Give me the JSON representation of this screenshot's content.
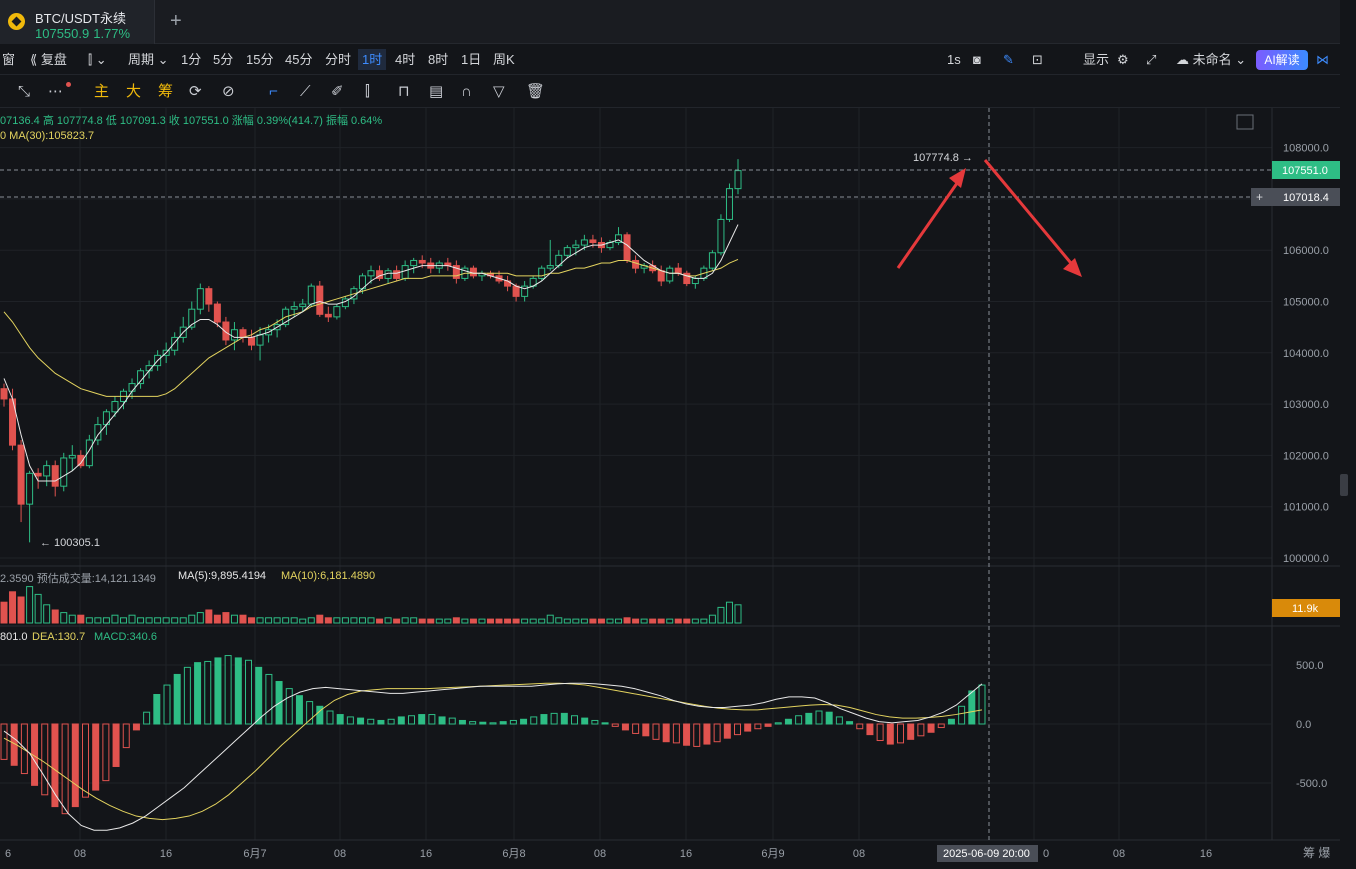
{
  "tab": {
    "symbol": "BTC/USDT永续",
    "price": "107550.9",
    "change": "1.77%",
    "new_tab": "+"
  },
  "toolbar": {
    "left_items": [
      "窗",
      "复盘",
      "",
      "周期"
    ],
    "intervals": [
      "1分",
      "5分",
      "15分",
      "45分",
      "分时",
      "1时",
      "4时",
      "8时",
      "1日",
      "周K"
    ],
    "active_interval": "1时",
    "right_items": [
      "1s",
      "显示",
      "未命名"
    ],
    "ai_label": "AI解读"
  },
  "toolbar2": {
    "chars": [
      "主",
      "大",
      "筹"
    ]
  },
  "info": {
    "ohlc": "07136.4  高 107774.8  低 107091.3  收 107551.0  涨幅 0.39%(414.7)  振幅 0.64%",
    "ma_label": "0  MA(30):105823.7",
    "vol": "2.3590  预估成交量:14,121.1349",
    "vol_ma5": "MA(5):9,895.4194",
    "vol_ma10": "MA(10):6,181.4890",
    "macd_dif": "801.0",
    "macd_dea": "DEA:130.7",
    "macd_val": "MACD:340.6"
  },
  "price_tags": {
    "last": "107551.0",
    "cursor": "107018.4",
    "vol_last": "11.9k",
    "high_label": "107774.8",
    "low_label": "100305.1"
  },
  "x_axis": {
    "labels": [
      "6",
      "08",
      "16",
      "6月7",
      "08",
      "16",
      "6月8",
      "08",
      "16",
      "6月9",
      "08",
      "0",
      "08",
      "16"
    ],
    "cursor_time": "2025-06-09 20:00",
    "corner": "筹  爆"
  },
  "colors": {
    "up": "#2ebd85",
    "down": "#e0534f",
    "ma_fast": "#e8e8e8",
    "ma_slow": "#e3d35f",
    "accent": "#3d8bfd",
    "arrow": "#e5393b"
  },
  "chart_data": [
    {
      "type": "candlestick",
      "title": "",
      "y_ticks": [
        108000.0,
        107000.0,
        106000.0,
        105000.0,
        104000.0,
        103000.0,
        102000.0,
        101000.0,
        100000.0
      ],
      "ylim": [
        99700,
        108300
      ],
      "interval": "1h",
      "candles": [
        [
          103300,
          103400,
          102950,
          103100
        ],
        [
          103100,
          103300,
          102100,
          102200
        ],
        [
          102200,
          102300,
          100700,
          101050
        ],
        [
          101050,
          101700,
          100305,
          101650
        ],
        [
          101650,
          101750,
          101350,
          101600
        ],
        [
          101600,
          101900,
          101400,
          101800
        ],
        [
          101800,
          101900,
          101200,
          101400
        ],
        [
          101400,
          102050,
          101300,
          101950
        ],
        [
          101950,
          102200,
          101700,
          102000
        ],
        [
          102000,
          102100,
          101750,
          101800
        ],
        [
          101800,
          102400,
          101750,
          102300
        ],
        [
          102300,
          102750,
          102200,
          102600
        ],
        [
          102600,
          102900,
          102400,
          102850
        ],
        [
          102850,
          103150,
          102750,
          103050
        ],
        [
          103050,
          103300,
          102900,
          103250
        ],
        [
          103250,
          103500,
          103100,
          103400
        ],
        [
          103400,
          103700,
          103300,
          103650
        ],
        [
          103650,
          103850,
          103500,
          103750
        ],
        [
          103750,
          104050,
          103650,
          103950
        ],
        [
          103950,
          104200,
          103800,
          104050
        ],
        [
          104050,
          104400,
          103950,
          104300
        ],
        [
          104300,
          104700,
          104200,
          104500
        ],
        [
          104500,
          105000,
          104450,
          104850
        ],
        [
          104850,
          105350,
          104750,
          105250
        ],
        [
          105250,
          105300,
          104800,
          104950
        ],
        [
          104950,
          105000,
          104500,
          104600
        ],
        [
          104600,
          104700,
          104150,
          104250
        ],
        [
          104250,
          104600,
          104050,
          104450
        ],
        [
          104450,
          104500,
          104200,
          104300
        ],
        [
          104300,
          104450,
          104050,
          104150
        ],
        [
          104150,
          104500,
          103850,
          104350
        ],
        [
          104350,
          104550,
          104200,
          104450
        ],
        [
          104450,
          104650,
          104300,
          104550
        ],
        [
          104550,
          104900,
          104500,
          104850
        ],
        [
          104850,
          105000,
          104700,
          104900
        ],
        [
          104900,
          105050,
          104800,
          104950
        ],
        [
          104950,
          105350,
          104900,
          105300
        ],
        [
          105300,
          105400,
          104700,
          104750
        ],
        [
          104750,
          104900,
          104600,
          104700
        ],
        [
          104700,
          104950,
          104650,
          104900
        ],
        [
          104900,
          105100,
          104850,
          105050
        ],
        [
          105050,
          105300,
          104950,
          105250
        ],
        [
          105250,
          105550,
          105150,
          105500
        ],
        [
          105500,
          105700,
          105350,
          105600
        ],
        [
          105600,
          105700,
          105400,
          105450
        ],
        [
          105450,
          105650,
          105350,
          105600
        ],
        [
          105600,
          105700,
          105400,
          105450
        ],
        [
          105450,
          105800,
          105400,
          105700
        ],
        [
          105700,
          105850,
          105550,
          105800
        ],
        [
          105800,
          105900,
          105650,
          105750
        ],
        [
          105750,
          105850,
          105550,
          105650
        ],
        [
          105650,
          105800,
          105550,
          105750
        ],
        [
          105750,
          105850,
          105600,
          105700
        ],
        [
          105700,
          105800,
          105350,
          105450
        ],
        [
          105450,
          105700,
          105400,
          105650
        ],
        [
          105650,
          105700,
          105450,
          105500
        ],
        [
          105500,
          105600,
          105400,
          105550
        ],
        [
          105550,
          105600,
          105450,
          105500
        ],
        [
          105500,
          105600,
          105350,
          105400
        ],
        [
          105400,
          105500,
          105200,
          105300
        ],
        [
          105300,
          105350,
          105000,
          105100
        ],
        [
          105100,
          105400,
          105000,
          105300
        ],
        [
          105300,
          105500,
          105250,
          105450
        ],
        [
          105450,
          105700,
          105400,
          105650
        ],
        [
          105650,
          106200,
          105600,
          105700
        ],
        [
          105700,
          106000,
          105650,
          105900
        ],
        [
          105900,
          106100,
          105850,
          106050
        ],
        [
          106050,
          106200,
          105900,
          106100
        ],
        [
          106100,
          106300,
          106000,
          106200
        ],
        [
          106200,
          106300,
          106050,
          106150
        ],
        [
          106150,
          106250,
          105950,
          106050
        ],
        [
          106050,
          106200,
          106000,
          106150
        ],
        [
          106150,
          106450,
          106100,
          106300
        ],
        [
          106300,
          106350,
          105750,
          105800
        ],
        [
          105800,
          105900,
          105550,
          105650
        ],
        [
          105650,
          105750,
          105550,
          105700
        ],
        [
          105700,
          105800,
          105550,
          105600
        ],
        [
          105600,
          105700,
          105300,
          105400
        ],
        [
          105400,
          105700,
          105350,
          105650
        ],
        [
          105650,
          105750,
          105500,
          105550
        ],
        [
          105550,
          105600,
          105300,
          105350
        ],
        [
          105350,
          105500,
          105250,
          105450
        ],
        [
          105450,
          105700,
          105400,
          105650
        ],
        [
          105650,
          106000,
          105600,
          105950
        ],
        [
          105950,
          106700,
          105900,
          106600
        ],
        [
          106600,
          107300,
          106550,
          107200
        ],
        [
          107200,
          107775,
          107091,
          107551
        ]
      ],
      "ma_fast": {
        "name": "",
        "values": [
          103500,
          103100,
          102400,
          101800,
          101500,
          101500,
          101500,
          101600,
          101700,
          101850,
          102100,
          102400,
          102600,
          102800,
          103000,
          103250,
          103450,
          103650,
          103850,
          104000,
          104200,
          104400,
          104550,
          104650,
          104650,
          104550,
          104400,
          104300,
          104300,
          104300,
          104350,
          104400,
          104500,
          104600,
          104700,
          104800,
          104950,
          105000,
          104950,
          104950,
          105000,
          105100,
          105250,
          105400,
          105500,
          105550,
          105550,
          105600,
          105650,
          105700,
          105700,
          105700,
          105700,
          105650,
          105600,
          105550,
          105550,
          105500,
          105450,
          105400,
          105300,
          105250,
          105300,
          105400,
          105550,
          105700,
          105850,
          105950,
          106050,
          106100,
          106100,
          106150,
          106200,
          106100,
          105950,
          105800,
          105700,
          105600,
          105550,
          105550,
          105500,
          105450,
          105450,
          105550,
          105800,
          106150,
          106500
        ]
      },
      "ma_slow": {
        "name": "MA(30)",
        "values": [
          104800,
          104600,
          104350,
          104100,
          103900,
          103750,
          103600,
          103500,
          103400,
          103300,
          103250,
          103200,
          103150,
          103150,
          103150,
          103150,
          103150,
          103150,
          103150,
          103200,
          103300,
          103450,
          103600,
          103750,
          103900,
          104000,
          104100,
          104200,
          104300,
          104350,
          104450,
          104500,
          104600,
          104700,
          104750,
          104800,
          104900,
          104950,
          105000,
          105050,
          105100,
          105150,
          105200,
          105250,
          105300,
          105350,
          105400,
          105450,
          105450,
          105450,
          105500,
          105500,
          105500,
          105500,
          105550,
          105550,
          105550,
          105550,
          105550,
          105550,
          105500,
          105500,
          105500,
          105500,
          105550,
          105550,
          105600,
          105650,
          105650,
          105700,
          105750,
          105750,
          105800,
          105800,
          105750,
          105700,
          105650,
          105600,
          105550,
          105550,
          105500,
          105500,
          105550,
          105600,
          105650,
          105750,
          105820
        ]
      }
    },
    {
      "type": "bar",
      "title": "",
      "values": [
        8,
        12,
        10,
        14,
        11,
        7,
        5,
        4,
        3,
        3,
        2,
        2,
        2,
        3,
        2,
        3,
        2,
        2,
        2,
        2,
        2,
        2,
        3,
        4,
        5,
        3,
        4,
        3,
        3,
        2,
        2,
        2,
        2,
        2,
        2,
        1.5,
        2,
        3,
        2,
        2,
        2,
        2,
        2,
        2,
        1.5,
        2,
        1.5,
        2,
        2,
        1.5,
        1.5,
        1.5,
        1.5,
        2,
        1.5,
        1.5,
        1.5,
        1.5,
        1.5,
        1.5,
        1.5,
        1.5,
        1.5,
        1.5,
        3,
        2,
        1.5,
        1.5,
        1.5,
        1.5,
        1.5,
        1.5,
        1.5,
        2,
        1.5,
        1.5,
        1.5,
        1.5,
        1.5,
        1.5,
        1.5,
        1.5,
        1.5,
        3,
        6,
        8,
        7
      ],
      "up": [
        false,
        false,
        false,
        true,
        true,
        true,
        false,
        true,
        true,
        false,
        true,
        true,
        true,
        true,
        true,
        true,
        true,
        true,
        true,
        true,
        true,
        true,
        true,
        true,
        false,
        false,
        false,
        true,
        false,
        false,
        true,
        true,
        true,
        true,
        true,
        true,
        true,
        false,
        false,
        true,
        true,
        true,
        true,
        true,
        false,
        true,
        false,
        true,
        true,
        false,
        false,
        true,
        true,
        false,
        true,
        false,
        true,
        false,
        false,
        false,
        false,
        true,
        true,
        true,
        true,
        true,
        true,
        true,
        true,
        false,
        false,
        true,
        true,
        false,
        false,
        true,
        false,
        false,
        true,
        false,
        false,
        true,
        true,
        true,
        true,
        true,
        true
      ]
    },
    {
      "type": "bar",
      "title": "",
      "y_ticks": [
        500.0,
        0.0,
        -500.0
      ],
      "ylim": [
        -950,
        650
      ],
      "histogram": [
        -300,
        -350,
        -420,
        -520,
        -600,
        -700,
        -760,
        -700,
        -620,
        -560,
        -480,
        -360,
        -200,
        -50,
        100,
        250,
        330,
        420,
        480,
        520,
        530,
        560,
        580,
        560,
        540,
        480,
        420,
        360,
        300,
        240,
        190,
        150,
        110,
        80,
        60,
        50,
        40,
        30,
        40,
        60,
        70,
        80,
        80,
        60,
        50,
        30,
        20,
        15,
        10,
        20,
        30,
        40,
        60,
        80,
        90,
        90,
        70,
        50,
        30,
        10,
        -20,
        -50,
        -80,
        -100,
        -130,
        -150,
        -160,
        -180,
        -190,
        -170,
        -150,
        -120,
        -90,
        -60,
        -40,
        -20,
        10,
        40,
        70,
        90,
        110,
        100,
        60,
        20,
        -40,
        -90,
        -140,
        -170,
        -160,
        -130,
        -100,
        -70,
        -30,
        40,
        150,
        280,
        330
      ],
      "dif": [
        -60,
        -140,
        -250,
        -420,
        -600,
        -760,
        -860,
        -900,
        -900,
        -880,
        -840,
        -780,
        -700,
        -620,
        -540,
        -440,
        -340,
        -240,
        -140,
        -40,
        60,
        150,
        220,
        270,
        300,
        310,
        300,
        290,
        280,
        270,
        260,
        260,
        270,
        280,
        290,
        300,
        310,
        320,
        320,
        320,
        320,
        320,
        330,
        340,
        345,
        345,
        340,
        330,
        320,
        300,
        270,
        240,
        200,
        170,
        150,
        140,
        140,
        150,
        160,
        180,
        210,
        230,
        230,
        220,
        180,
        130,
        90,
        50,
        20,
        10,
        20,
        30,
        60,
        100,
        160,
        250,
        340
      ],
      "dea": [
        -120,
        -180,
        -250,
        -320,
        -400,
        -480,
        -560,
        -630,
        -690,
        -740,
        -780,
        -800,
        -810,
        -800,
        -780,
        -740,
        -680,
        -600,
        -500,
        -400,
        -290,
        -180,
        -80,
        20,
        120,
        200,
        250,
        280,
        290,
        300,
        300,
        300,
        300,
        305,
        310,
        315,
        320,
        325,
        330,
        335,
        340,
        345,
        345,
        340,
        330,
        310,
        290,
        270,
        250,
        230,
        210,
        190,
        170,
        150,
        135,
        125,
        120,
        120,
        130,
        140,
        150,
        160,
        165,
        160,
        140,
        110,
        80,
        60,
        50,
        50,
        55,
        65,
        80,
        100,
        120
      ]
    }
  ]
}
